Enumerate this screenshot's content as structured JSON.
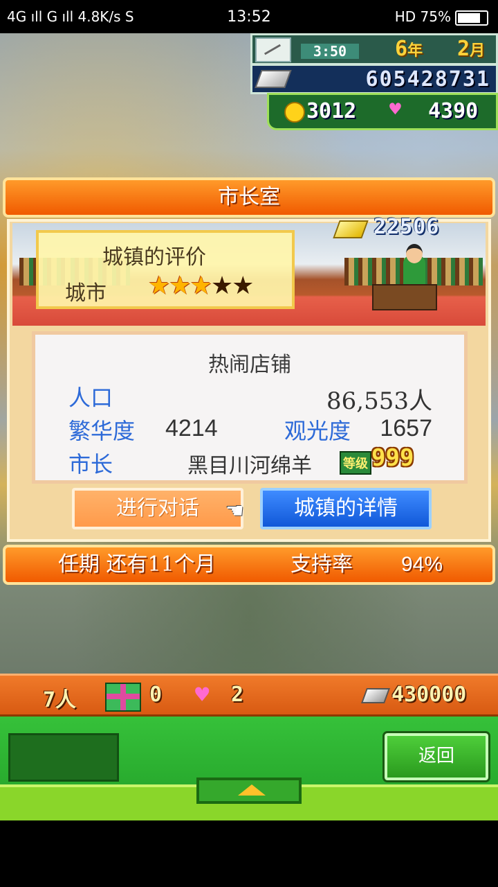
{
  "status_bar": {
    "left": "4G ıll G ıll 4.8K/s S",
    "time": "13:52",
    "right": "HD 75%"
  },
  "hud": {
    "time": "3:50",
    "year": "6",
    "year_unit": "年",
    "month": "2",
    "month_unit": "月",
    "money": "605428731",
    "coins": "3012",
    "hearts": "4390"
  },
  "dialog": {
    "title": "市长室",
    "gold_bars": "22506",
    "rating_title": "城镇的评价",
    "rating_rank": "城市",
    "stars_filled": 3,
    "stars_total": 5,
    "info": {
      "shop_name": "热闹店铺",
      "population_label": "人口",
      "population_value": "86,553人",
      "prosperity_label": "繁华度",
      "prosperity_value": "4214",
      "tourism_label": "观光度",
      "tourism_value": "1657",
      "mayor_label": "市长",
      "mayor_name": "黑目川河绵羊",
      "level_tag": "等级",
      "level_value": "999"
    },
    "talk_button": "进行对话",
    "details_button": "城镇的详情",
    "term_text": "任期 还有11个月",
    "approval_label": "支持率",
    "approval_value": "94%"
  },
  "bottom_stats": {
    "people": "7人",
    "gifts": "0",
    "hearts": "2",
    "silver": "430000"
  },
  "back_button": "返回",
  "colors": {
    "accent_orange": "#f05a00",
    "accent_blue": "#1058d8",
    "panel_green": "#22a028"
  }
}
